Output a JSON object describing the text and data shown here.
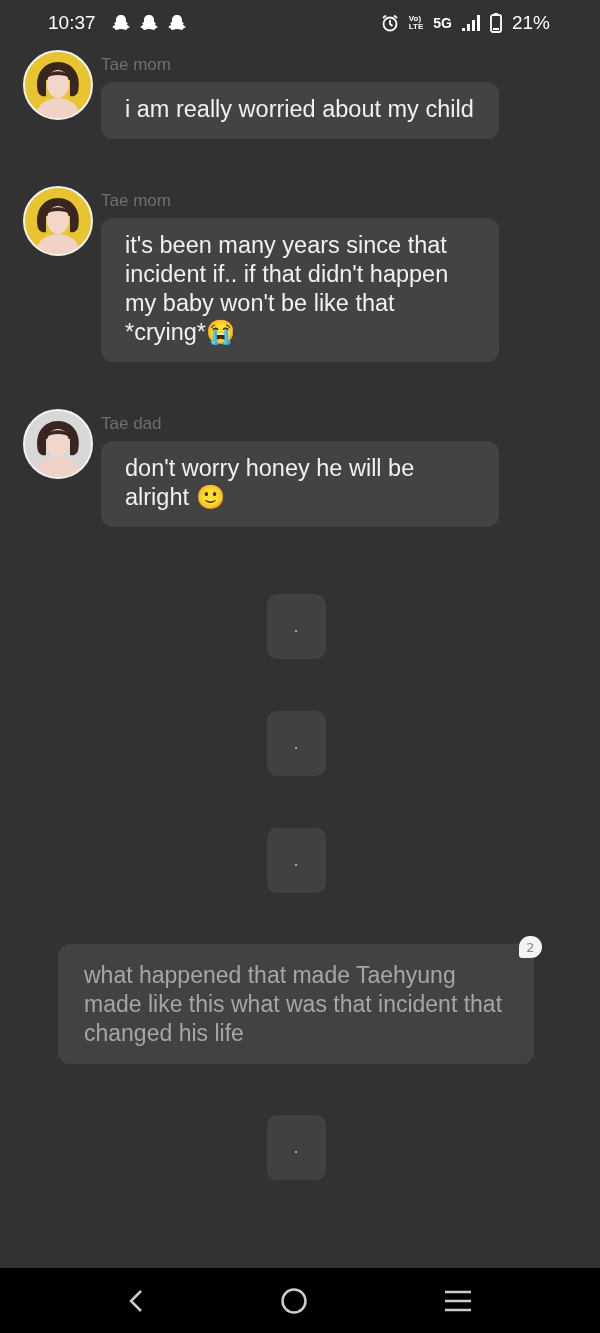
{
  "status_bar": {
    "time": "10:37",
    "volte_top": "Vo)",
    "volte_bottom": "LTE",
    "network": "5G",
    "battery": "21%"
  },
  "messages": [
    {
      "kind": "character",
      "name": "Tae mom",
      "color": "#e8c530",
      "text": "i am really worried about my child"
    },
    {
      "kind": "character",
      "name": "Tae mom",
      "color": "#e8c530",
      "text": "it's been many years since that incident if.. if that didn't happen my baby won't be like that *crying*😭"
    },
    {
      "kind": "character",
      "name": "Tae dad",
      "color": "#d8d8d8",
      "text": "don't worry honey he will be alright 🙂"
    },
    {
      "kind": "dot",
      "text": "."
    },
    {
      "kind": "dot",
      "text": "."
    },
    {
      "kind": "dot",
      "text": "."
    },
    {
      "kind": "narration",
      "text": "what happened that made Taehyung made like this what was that incident that changed his life",
      "badge": "2"
    },
    {
      "kind": "dot",
      "text": "."
    }
  ]
}
